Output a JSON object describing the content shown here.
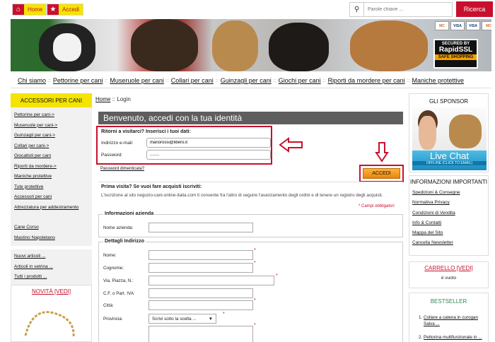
{
  "topbar": {
    "home_label": "Home",
    "accedi_label": "Accedi",
    "search_placeholder": "Parole chiave ...",
    "search_button": "Ricerca"
  },
  "banner": {
    "cards": [
      "MC",
      "VISA",
      "VISA",
      "MC"
    ],
    "ssl_secured": "SECURED BY",
    "ssl_brand": "RapidSSL",
    "ssl_safe": "SAFE SHOPPING"
  },
  "nav": {
    "items": [
      "Chi siamo",
      "Pettorine per cani",
      "Museruole per cani",
      "Collari per cani",
      "Guinzagli per cani",
      "Giochi per cani",
      "Riporti da mordere per cani",
      "Maniche protettive"
    ],
    "separator": "::"
  },
  "left_sidebar": {
    "title": "ACCESSORI PER CANI",
    "links": [
      "Pettorine per cani->",
      "Museruole per cani->",
      "Guinzagli per cani->",
      "Collari per cani->",
      "Giocattoli per cani",
      "Riporti da mordere->",
      "Maniche protettive",
      "Tute protettive",
      "Accessori per cani",
      "Attrezzatura per addestramento"
    ],
    "breed_links": [
      "Cane Corso",
      "Mastino Napoletano"
    ],
    "extra_links": [
      "Nuovi articoli ...",
      "Articoli in vetrina ...",
      "Tutti i prodotti ..."
    ],
    "novita": "NOVITÀ [VEDI]"
  },
  "breadcrumb": {
    "home": "Home",
    "sep": "::",
    "current": "Login"
  },
  "login": {
    "welcome": "Benvenuto, accedi con la tua identità",
    "returning": "Ritorni a visitarci? Inserisci i tuoi dati:",
    "email_label": "Indirizzo e-mail:",
    "email_value": "mariorossi@libero.it",
    "password_label": "Password:",
    "password_value": "........",
    "forgot": "Password dimenticata?",
    "submit": "ACCEDI"
  },
  "register": {
    "first_visit": "Prima visita? Se vuoi fare acquisti iscriviti:",
    "text": "L'iscrizione al sito negozio-cani-online-italia.com ti consente fra l'altro di seguire l'avanzamento degli ordini e di tenere un registro degli acquisti.",
    "required_note": "* Campi obbligatori",
    "company_legend": "Informazioni azienda",
    "company_label": "Nome azienda:",
    "address_legend": "Dettagli Indirizzo",
    "fields": [
      "Nome:",
      "Cognome:",
      "Via, Piazza, N.:",
      "C.F. o Part. IVA:",
      "Città:",
      "Provincia:"
    ],
    "province_select": "Scrivi sotto la scelta ...",
    "required_mark": "*"
  },
  "right_sidebar": {
    "sponsor_title": "GLI SPONSOR",
    "live_chat": "Live Chat",
    "live_sub": "OFFLINE (CLICK TO EMAIL)",
    "info_title": "INFORMAZIONI IMPORTANTI",
    "info_links": [
      "Spedizioni & Consegne",
      "Normativa Privacy",
      "Condizioni di Vendita",
      "Info & Contatti",
      "Mappa del Sito",
      "Cancella Newsletter"
    ],
    "cart_title": "CARRELLO [VEDI]",
    "cart_status": "è vuoto",
    "best_title": "BESTSELLER",
    "best_items": [
      "Collare a catena in curogan Salva ...",
      "Pettorina multifunzionale in ..."
    ]
  },
  "colors": {
    "accent_red": "#c8102e",
    "accent_yellow": "#f5e400",
    "accent_orange": "#f5a100"
  }
}
